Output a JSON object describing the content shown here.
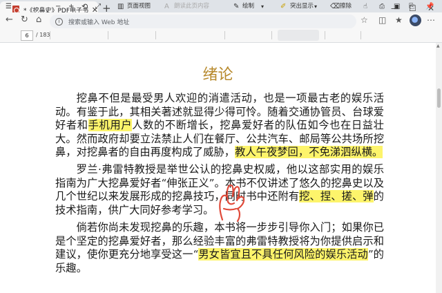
{
  "browser": {
    "tab_title": "*《挖鼻史》PDF电子书.pdf",
    "tab_close": "✕",
    "new_tab": "+",
    "window_controls": {
      "minimize": "—",
      "maximize": "☐",
      "close": "✕"
    },
    "address_placeholder": "搜索或输入 Web 地址"
  },
  "pdf_toolbar": {
    "current_page": "6",
    "total_pages": "/ 183",
    "page_view": "页面视图",
    "read_aloud": "朗读此页内容",
    "draw": "绘制",
    "highlight": "突出显示",
    "erase": "擦除"
  },
  "document": {
    "chapter_title": "绪论",
    "paragraph1": {
      "p1": "挖鼻不但是最受男人欢迎的消遣活动，也是一项最古老的娱乐活动。有鉴于此，其相关著述就显得少得可怜。随着交通协管员、台球爱好者和",
      "h1": "手机用户",
      "p2": "人数的不断增长，挖鼻爱好者的队伍如今也在日益壮大。然而政府却要立法禁止人们在餐厅、公共汽车、邮局等公共场所挖鼻，对挖鼻者的自由再度构成了威胁，",
      "h2": "教人午夜梦回，不免涕泗纵横。"
    },
    "paragraph2": {
      "p1": "罗兰·弗雷特教授是举世公认的挖鼻史权威，他以这部实用的娱乐指南为广大挖鼻爱好者“伸张正义”。本书不仅讲述了悠久的挖鼻史以及几个世纪以来发展形成的挖鼻技巧，同时书中还附有",
      "h1": "挖、捏、搓、弹",
      "p2": "的技术指南，供广大同好参考学习。"
    },
    "paragraph3": {
      "p1": "倘若你尚未发现挖鼻的乐趣，本书将一步步引导你入门；如果你已是个坚定的挖鼻爱好者，那么经验丰富的弗雷特教授将为你提供启示和建议，使你更充分地享受这一“",
      "h1": "男女皆宜且不具任何风险的娱乐活动",
      "p2": "”的乐趣。"
    }
  },
  "colors": {
    "highlight": "#fdf46b",
    "title": "#b7892c",
    "hand": "#e04a3a"
  }
}
